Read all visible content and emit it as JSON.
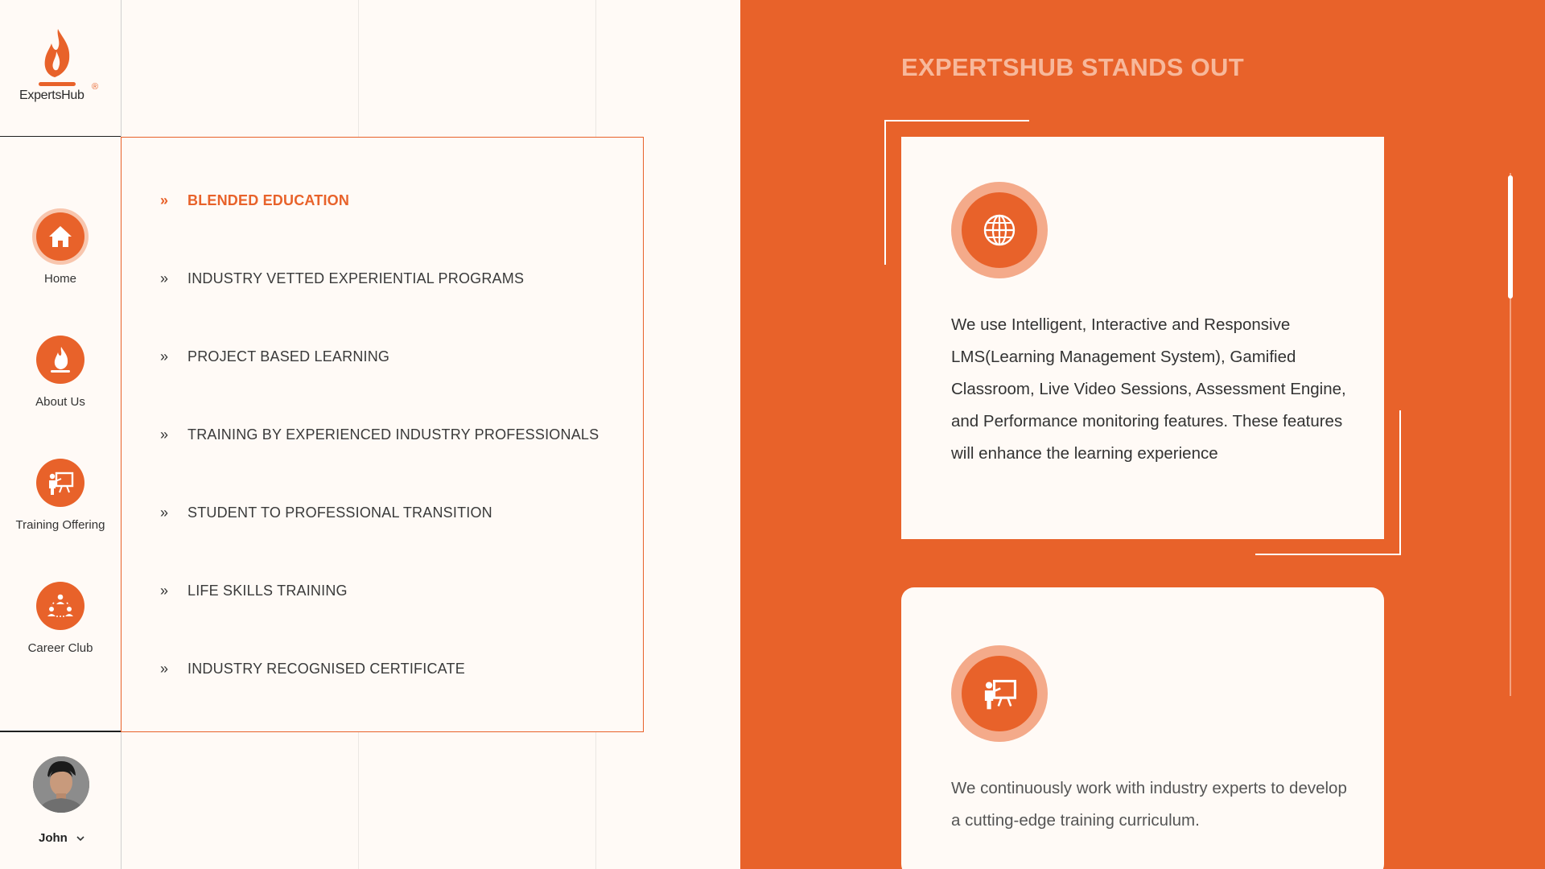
{
  "brand": {
    "name": "ExpertsHub",
    "registered_mark": "®",
    "accent": "#e8622a",
    "accent_light": "#f4aa8a"
  },
  "nav": {
    "items": [
      {
        "label": "Home",
        "icon": "home-icon",
        "active": true
      },
      {
        "label": "About Us",
        "icon": "flame-icon",
        "active": false
      },
      {
        "label": "Training Offering",
        "icon": "presenter-board-icon",
        "active": false
      },
      {
        "label": "Career Club",
        "icon": "group-network-icon",
        "active": false
      }
    ]
  },
  "user": {
    "name": "John"
  },
  "features": {
    "items": [
      {
        "label": "BLENDED EDUCATION",
        "active": true
      },
      {
        "label": "INDUSTRY VETTED EXPERIENTIAL PROGRAMS",
        "active": false
      },
      {
        "label": "PROJECT BASED LEARNING",
        "active": false
      },
      {
        "label": "TRAINING BY EXPERIENCED INDUSTRY PROFESSIONALS",
        "active": false
      },
      {
        "label": "STUDENT TO PROFESSIONAL TRANSITION",
        "active": false
      },
      {
        "label": "LIFE SKILLS TRAINING",
        "active": false
      },
      {
        "label": "INDUSTRY RECOGNISED CERTIFICATE",
        "active": false
      }
    ]
  },
  "standout": {
    "title": "EXPERTSHUB STANDS OUT",
    "cards": [
      {
        "icon": "globe-icon",
        "text": "We use Intelligent, Interactive and Responsive LMS(Learning Management System), Gamified Classroom, Live Video Sessions, Assessment Engine, and Performance monitoring features. These features will enhance the learning experience"
      },
      {
        "icon": "presenter-board-icon",
        "text": "We continuously work with industry experts to develop a cutting-edge training curriculum."
      }
    ]
  }
}
